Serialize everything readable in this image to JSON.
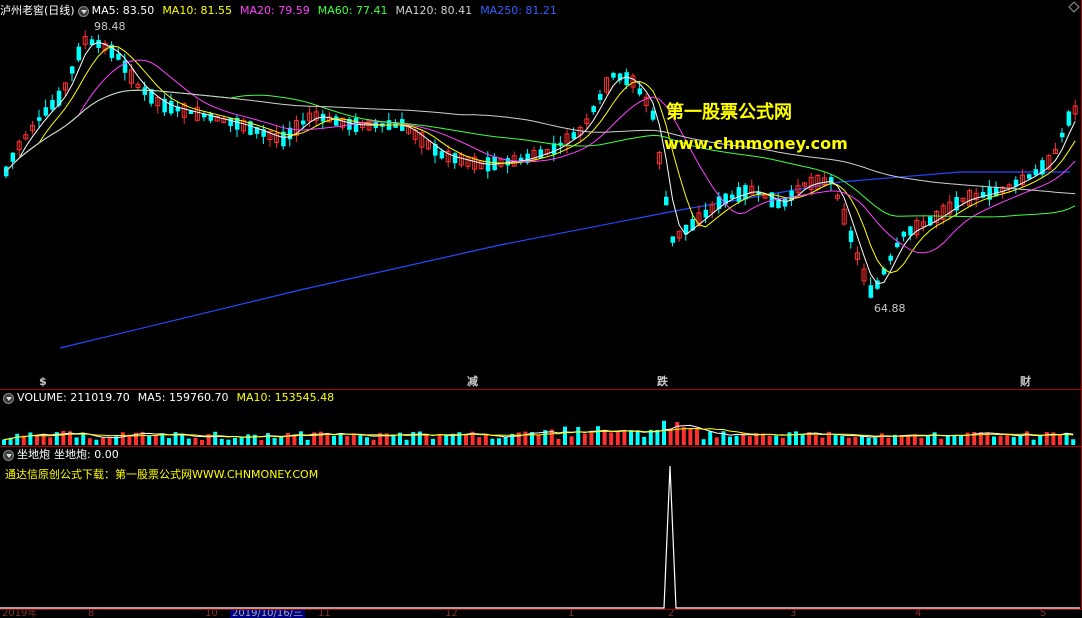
{
  "header": {
    "stock_name": "泸州老窖(日线)",
    "ma": [
      {
        "label": "MA5: 83.50",
        "color": "#ffffff"
      },
      {
        "label": "MA10: 81.55",
        "color": "#ffff00"
      },
      {
        "label": "MA20: 79.59",
        "color": "#ff40ff"
      },
      {
        "label": "MA60: 77.41",
        "color": "#40ff40"
      },
      {
        "label": "MA120: 80.41",
        "color": "#d0d0d0"
      },
      {
        "label": "MA250: 81.21",
        "color": "#3060ff"
      }
    ]
  },
  "price_labels": {
    "high": "98.48",
    "low": "64.88"
  },
  "flags": [
    {
      "text": "$",
      "color": "#ff3030"
    },
    {
      "text": "减",
      "color": "#40ff40"
    },
    {
      "text": "跌",
      "color": "#40ff40"
    },
    {
      "text": "财",
      "color": "#40a0ff"
    }
  ],
  "watermark": {
    "line1": "第一股票公式网",
    "line2": "www.chnmoney.com"
  },
  "volume_header": {
    "volume": "VOLUME: 211019.70",
    "ma5": "MA5: 159760.70",
    "ma10": "MA10: 153545.48"
  },
  "indicator_header": {
    "name": "坐地炮",
    "value": "坐地炮: 0.00"
  },
  "indicator_note": "通达信原创公式下载：第一股票公式网WWW.CHNMONEY.COM",
  "date_axis": {
    "items": [
      "2019年",
      "8",
      "10",
      "2019/10/16/三",
      "11",
      "12",
      "1",
      "2",
      "3",
      "4",
      "5"
    ]
  },
  "colors": {
    "up": "#ff3030",
    "down": "#00ffff",
    "panel_border": "#aa0000"
  }
}
